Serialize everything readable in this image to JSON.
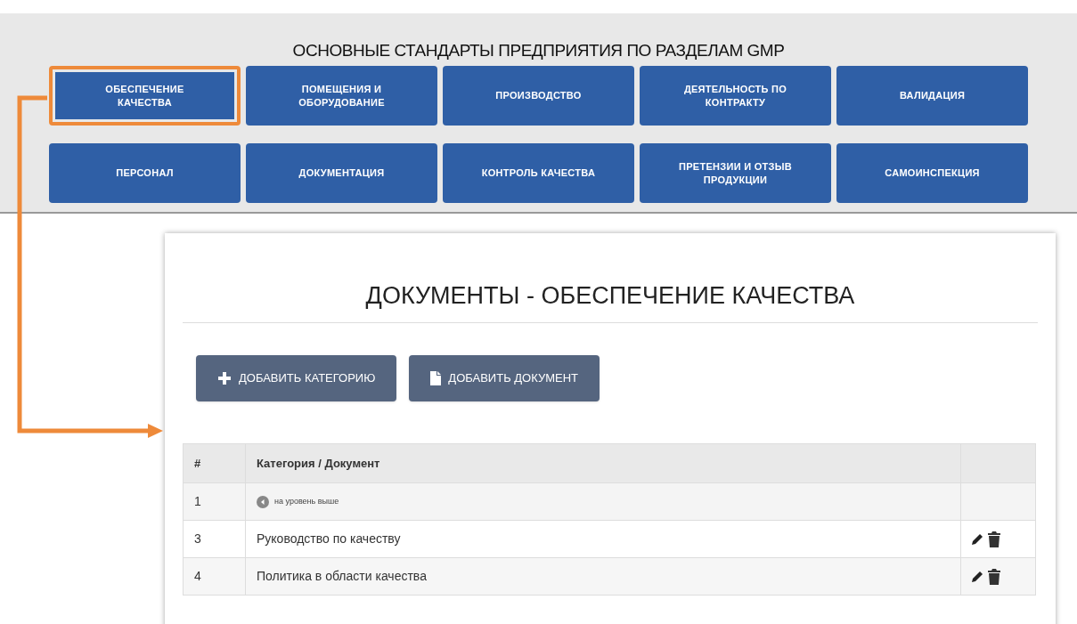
{
  "header": {
    "title": "ОСНОВНЫЕ СТАНДАРТЫ ПРЕДПРИЯТИЯ ПО РАЗДЕЛАМ GMP"
  },
  "sections": [
    {
      "label": "ОБЕСПЕЧЕНИЕ КАЧЕСТВА",
      "selected": true
    },
    {
      "label": "ПОМЕЩЕНИЯ И ОБОРУДОВАНИЕ",
      "selected": false
    },
    {
      "label": "ПРОИЗВОДСТВО",
      "selected": false
    },
    {
      "label": "ДЕЯТЕЛЬНОСТЬ ПО КОНТРАКТУ",
      "selected": false
    },
    {
      "label": "ВАЛИДАЦИЯ",
      "selected": false
    },
    {
      "label": "ПЕРСОНАЛ",
      "selected": false
    },
    {
      "label": "ДОКУМЕНТАЦИЯ",
      "selected": false
    },
    {
      "label": "КОНТРОЛЬ КАЧЕСТВА",
      "selected": false
    },
    {
      "label": "ПРЕТЕНЗИИ И ОТЗЫВ ПРОДУКЦИИ",
      "selected": false
    },
    {
      "label": "САМОИНСПЕКЦИЯ",
      "selected": false
    }
  ],
  "panel": {
    "title": "ДОКУМЕНТЫ - ОБЕСПЕЧЕНИЕ КАЧЕСТВА",
    "actions": [
      {
        "kind": "category",
        "label": "ДОБАВИТЬ КАТЕГОРИЮ"
      },
      {
        "kind": "document",
        "label": "ДОБАВИТЬ ДОКУМЕНТ"
      }
    ],
    "table": {
      "columns": [
        "#",
        "Категория / Документ"
      ],
      "rows": [
        {
          "kind": "up",
          "number": "1",
          "name": "на уровень выше"
        },
        {
          "kind": "document",
          "number": "3",
          "name": "Руководство по качеству"
        },
        {
          "kind": "document",
          "number": "4",
          "name": "Политика в области качества"
        }
      ]
    }
  }
}
